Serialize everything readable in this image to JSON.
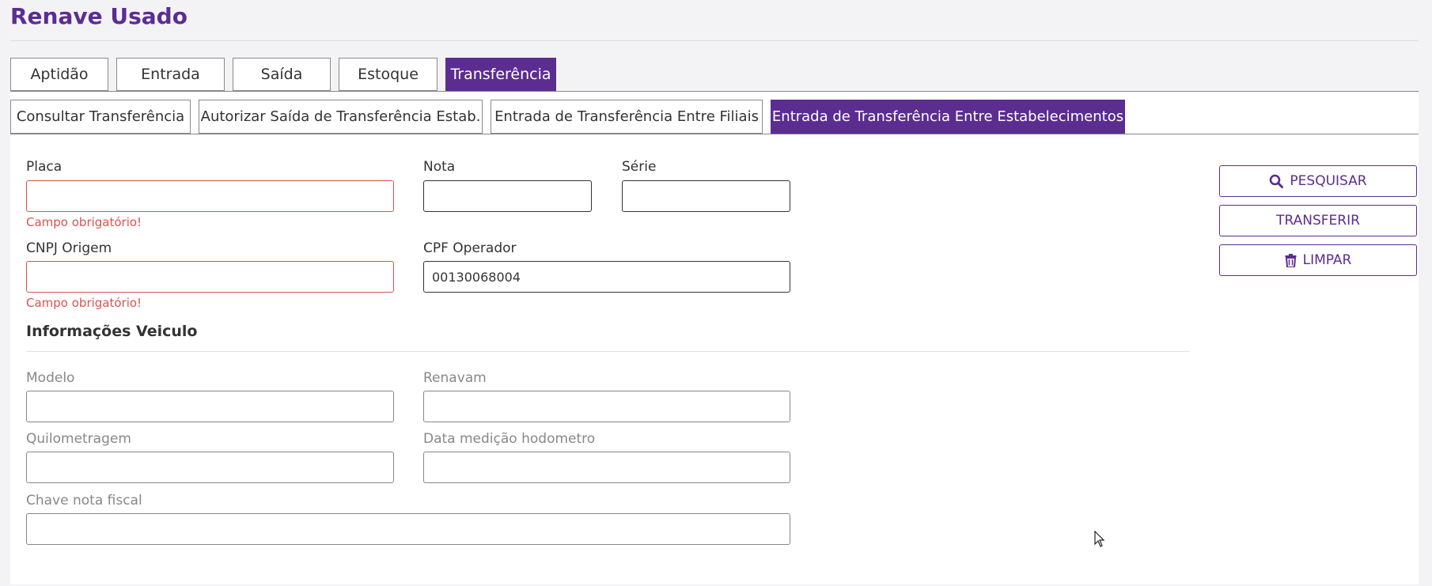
{
  "app": {
    "title": "Renave Usado"
  },
  "main_tabs": [
    {
      "label": "Aptidão",
      "active": false
    },
    {
      "label": "Entrada",
      "active": false
    },
    {
      "label": "Saída",
      "active": false
    },
    {
      "label": "Estoque",
      "active": false
    },
    {
      "label": "Transferência",
      "active": true
    }
  ],
  "sub_tabs": [
    {
      "label": "Consultar Transferência",
      "active": false
    },
    {
      "label": "Autorizar Saída de Transferência Estab.",
      "active": false
    },
    {
      "label": "Entrada de Transferência Entre Filiais",
      "active": false
    },
    {
      "label": "Entrada de Transferência Entre Estabelecimentos",
      "active": true
    }
  ],
  "form": {
    "placa": {
      "label": "Placa",
      "value": "",
      "error": "Campo obrigatório!"
    },
    "nota": {
      "label": "Nota",
      "value": ""
    },
    "serie": {
      "label": "Série",
      "value": ""
    },
    "cnpj_origem": {
      "label": "CNPJ Origem",
      "value": "",
      "error": "Campo obrigatório!"
    },
    "cpf_operador": {
      "label": "CPF Operador",
      "value": "00130068004"
    }
  },
  "vehicle_info": {
    "title": "Informações Veiculo",
    "modelo": {
      "label": "Modelo",
      "value": ""
    },
    "renavam": {
      "label": "Renavam",
      "value": ""
    },
    "quilometragem": {
      "label": "Quilometragem",
      "value": ""
    },
    "data_medicao": {
      "label": "Data medição hodometro",
      "value": ""
    },
    "chave_nota": {
      "label": "Chave nota fiscal",
      "value": ""
    }
  },
  "actions": {
    "pesquisar": {
      "label": "PESQUISAR",
      "icon": "search-icon"
    },
    "transferir": {
      "label": "TRANSFERIR"
    },
    "limpar": {
      "label": "LIMPAR",
      "icon": "trash-icon"
    }
  },
  "colors": {
    "brand": "#5b2d91",
    "error": "#d9534f"
  }
}
